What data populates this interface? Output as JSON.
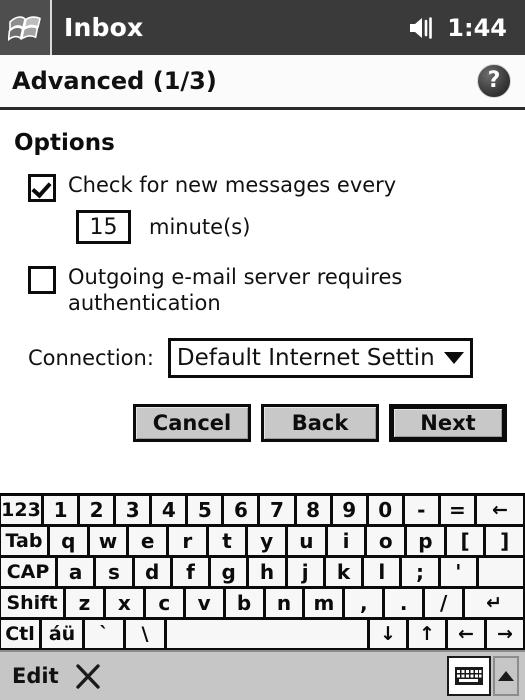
{
  "titlebar": {
    "app_name": "Inbox",
    "start_icon": "windows-flag-icon",
    "volume_icon": "speaker-icon",
    "clock": "1:44"
  },
  "header": {
    "title": "Advanced (1/3)",
    "help_icon": "help-question-icon"
  },
  "form": {
    "section_title": "Options",
    "check_new_messages": {
      "label": "Check for new messages every",
      "checked": true
    },
    "interval": {
      "value": "15",
      "placeholder": "15",
      "unit_label": "minute(s)"
    },
    "outgoing_auth": {
      "label": "Outgoing e-mail server requires authentication",
      "checked": false
    },
    "connection": {
      "label": "Connection:",
      "selected": "Default Internet Settin",
      "dropdown_icon": "chevron-down-icon"
    }
  },
  "buttons": {
    "cancel": "Cancel",
    "back": "Back",
    "next": "Next"
  },
  "keyboard": {
    "rows": [
      [
        "123",
        "1",
        "2",
        "3",
        "4",
        "5",
        "6",
        "7",
        "8",
        "9",
        "0",
        "-",
        "=",
        "←"
      ],
      [
        "Tab",
        "q",
        "w",
        "e",
        "r",
        "t",
        "y",
        "u",
        "i",
        "o",
        "p",
        "[",
        "]"
      ],
      [
        "CAP",
        "a",
        "s",
        "d",
        "f",
        "g",
        "h",
        "j",
        "k",
        "l",
        ";",
        "'",
        ""
      ],
      [
        "Shift",
        "z",
        "x",
        "c",
        "v",
        "b",
        "n",
        "m",
        ",",
        ".",
        "/",
        "↵"
      ],
      [
        "Ctl",
        "áü",
        "`",
        "\\",
        "",
        "↓",
        "↑",
        "←",
        "→"
      ]
    ]
  },
  "cmdbar": {
    "edit_label": "Edit",
    "pen_icon": "pen-cross-icon",
    "sip_icon": "keyboard-icon",
    "sip_arrow_icon": "triangle-up-icon"
  },
  "colors": {
    "titlebar_bg": "#3a3a3a",
    "cmdbar_bg": "#c6c6c6",
    "button_bg": "#c8c8c8",
    "ink": "#0b0b0b"
  }
}
